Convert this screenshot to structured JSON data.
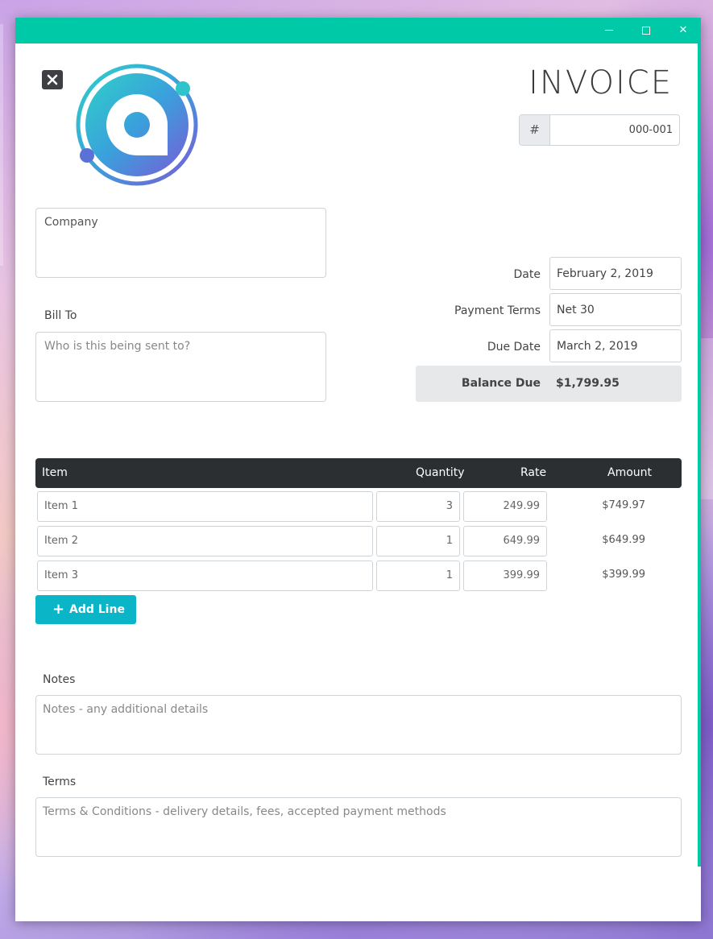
{
  "window": {
    "controls": {
      "minimize": "minimize",
      "maximize": "maximize",
      "close": "✕"
    }
  },
  "colors": {
    "accent": "#00c9a7",
    "button": "#0bb5c8",
    "header": "#2b2f31",
    "balance_bg": "#e6e8ea"
  },
  "header": {
    "title": "INVOICE",
    "number_prefix": "#",
    "number": "000-001"
  },
  "from": {
    "placeholder": "Company"
  },
  "bill_to": {
    "label": "Bill To",
    "placeholder": "Who is this being sent to?"
  },
  "details": {
    "date_label": "Date",
    "date": "February 2, 2019",
    "terms_label": "Payment Terms",
    "terms": "Net 30",
    "due_label": "Due Date",
    "due": "March 2, 2019",
    "balance_label": "Balance Due",
    "balance": "$1,799.95"
  },
  "table": {
    "columns": {
      "item": "Item",
      "quantity": "Quantity",
      "rate": "Rate",
      "amount": "Amount"
    },
    "rows": [
      {
        "item": "Item 1",
        "quantity": "3",
        "rate": "249.99",
        "amount": "$749.97"
      },
      {
        "item": "Item 2",
        "quantity": "1",
        "rate": "649.99",
        "amount": "$649.99"
      },
      {
        "item": "Item 3",
        "quantity": "1",
        "rate": "399.99",
        "amount": "$399.99"
      }
    ],
    "add_line_label": "Add Line"
  },
  "notes": {
    "label": "Notes",
    "placeholder": "Notes - any additional details"
  },
  "terms": {
    "label": "Terms",
    "placeholder": "Terms & Conditions - delivery details, fees, accepted payment methods"
  }
}
